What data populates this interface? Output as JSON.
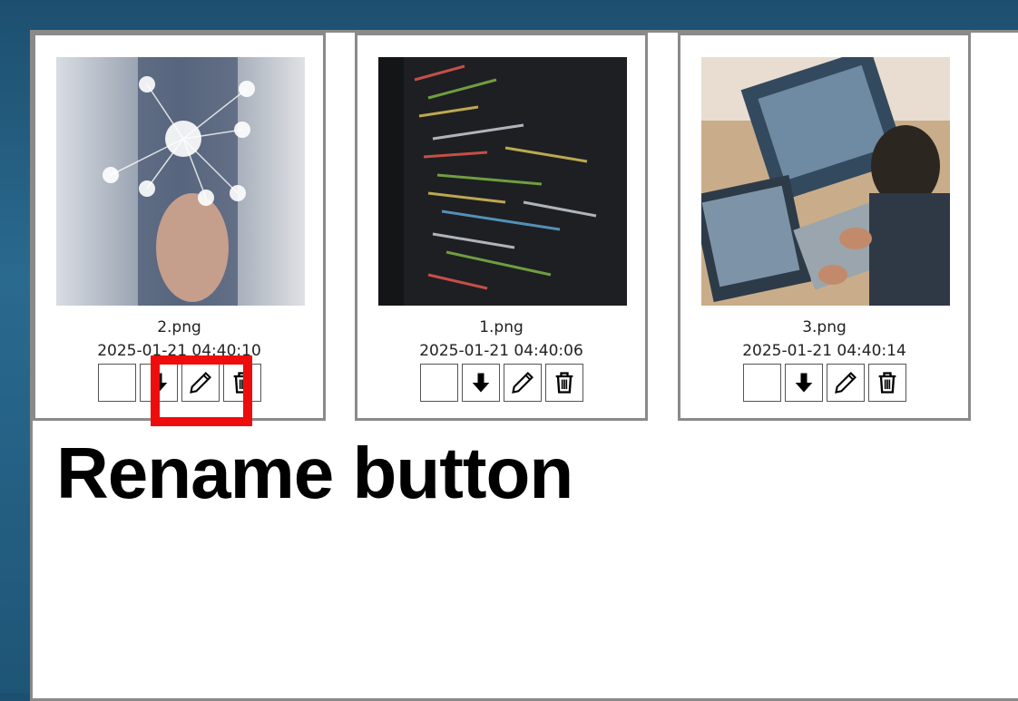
{
  "files": [
    {
      "name": "2.png",
      "date": "2025-01-21 04:40:10",
      "thumbnail": "network-touch-photo"
    },
    {
      "name": "1.png",
      "date": "2025-01-21 04:40:06",
      "thumbnail": "code-screen-photo"
    },
    {
      "name": "3.png",
      "date": "2025-01-21 04:40:14",
      "thumbnail": "laptop-workspace-photo"
    }
  ],
  "actions": {
    "select_icon": "empty-checkbox",
    "download_icon": "arrow-down-icon",
    "rename_icon": "pencil-icon",
    "delete_icon": "trash-icon"
  },
  "annotation": {
    "text": "Rename button",
    "highlight_color": "#ee0d0d"
  }
}
